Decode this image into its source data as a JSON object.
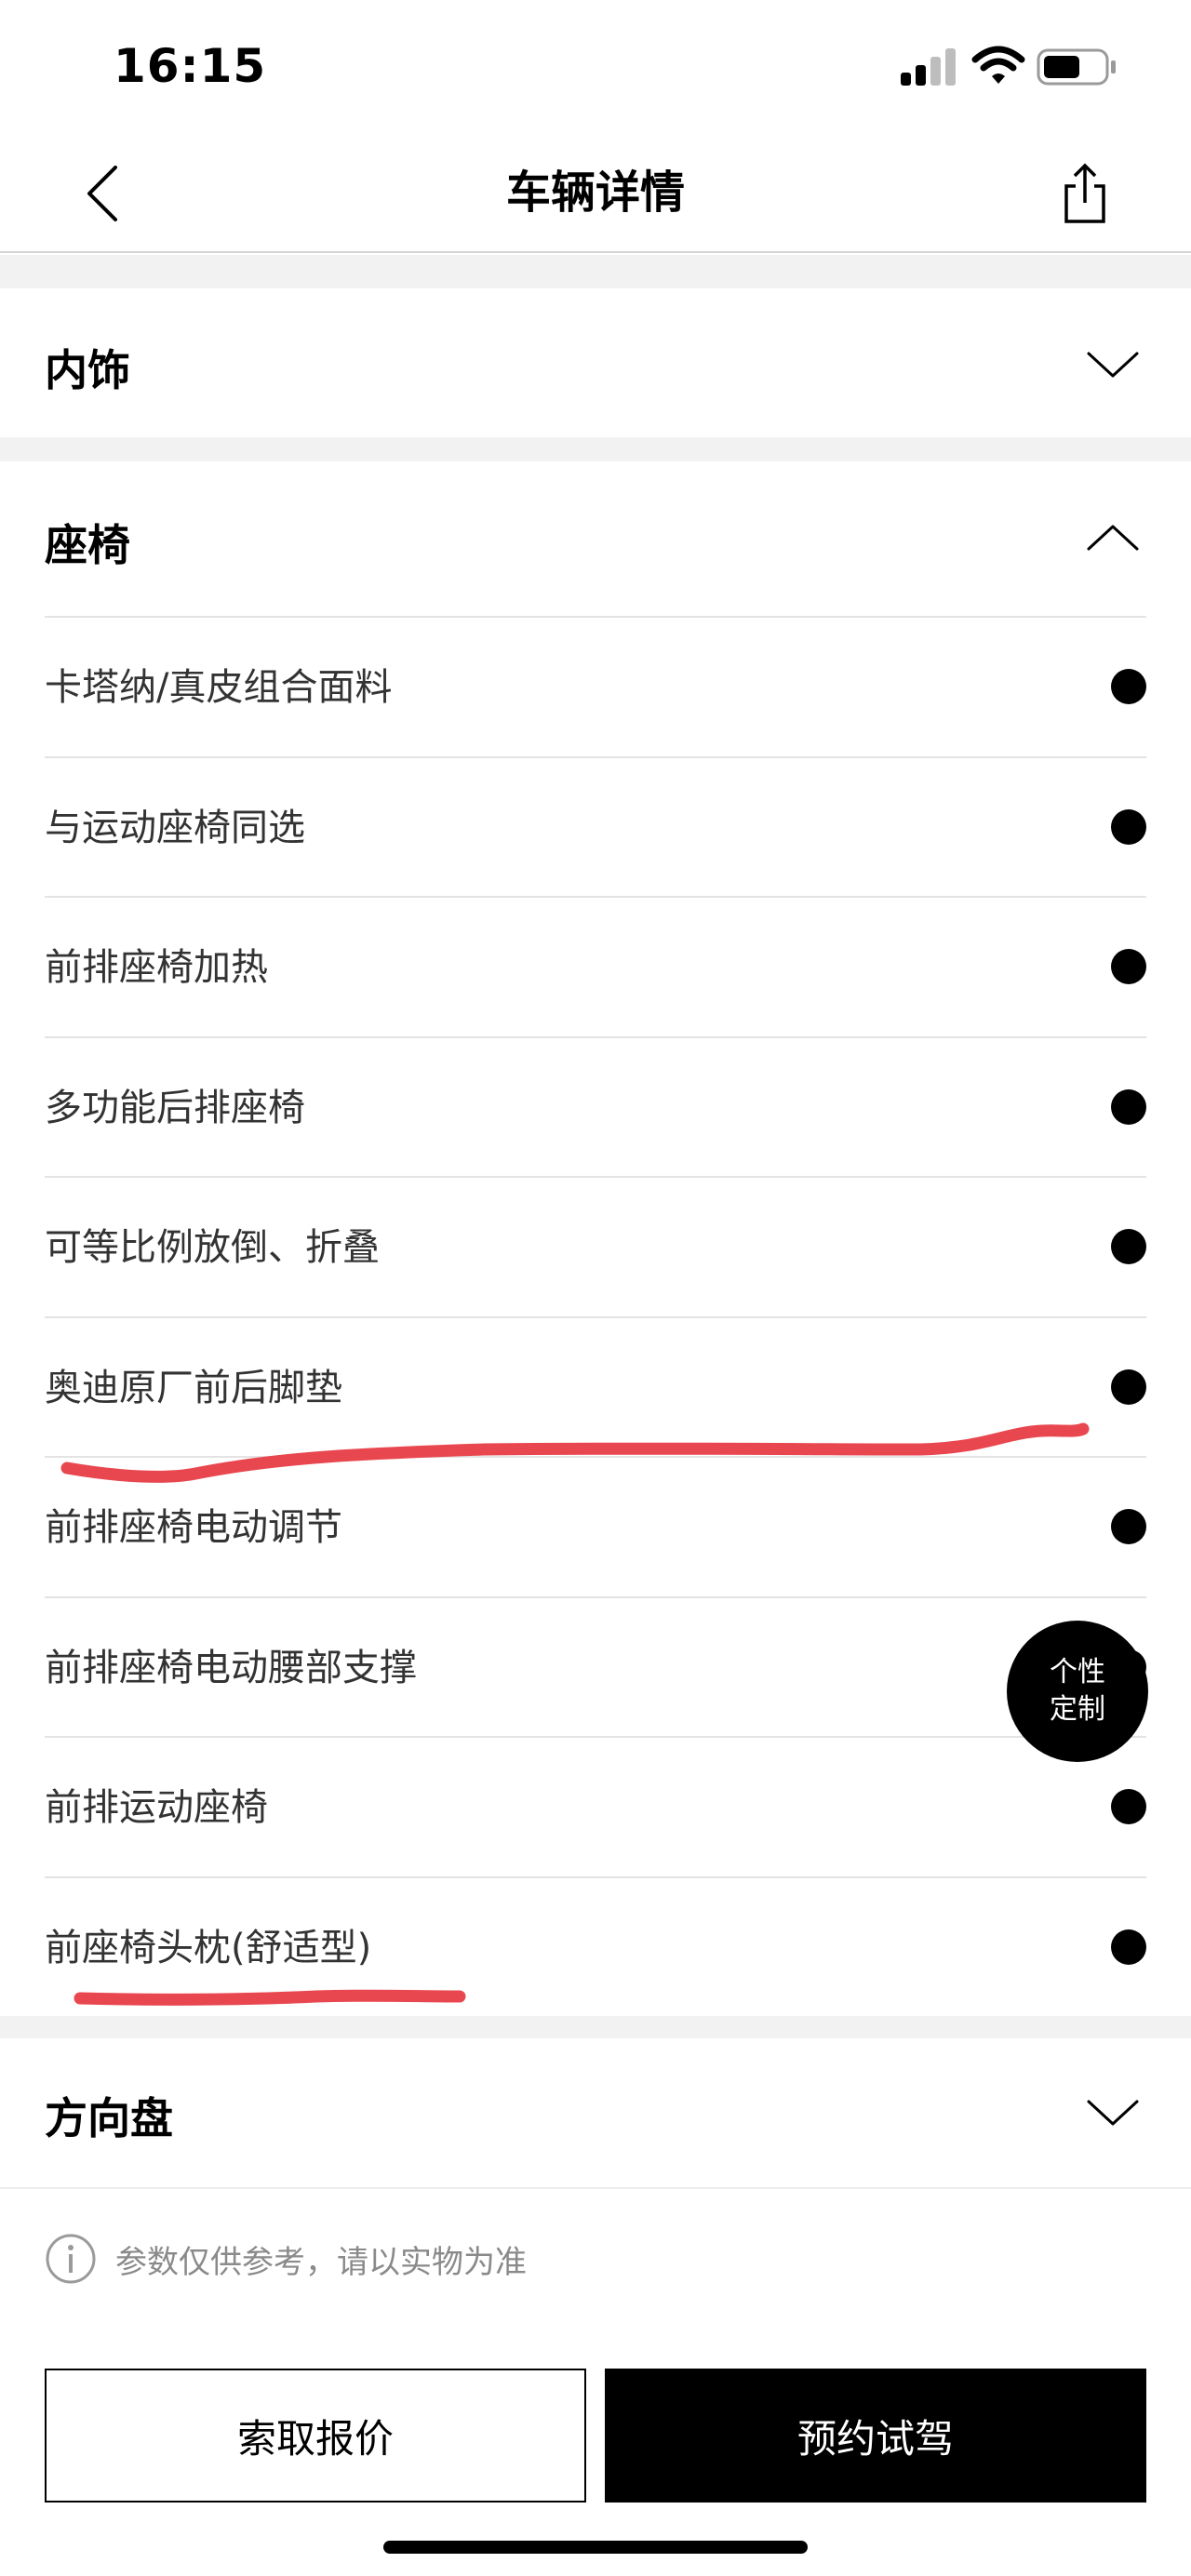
{
  "status_bar": {
    "time": "16:15"
  },
  "nav": {
    "title": "车辆详情"
  },
  "sections": {
    "interior": {
      "title": "内饰",
      "state": "collapsed"
    },
    "seats": {
      "title": "座椅",
      "state": "expanded"
    },
    "steering": {
      "title": "方向盘",
      "state": "collapsed"
    }
  },
  "seat_items": [
    "卡塔纳/真皮组合面料",
    "与运动座椅同选",
    "前排座椅加热",
    "多功能后排座椅",
    "可等比例放倒、折叠",
    "奥迪原厂前后脚垫",
    "前排座椅电动调节",
    "前排座椅电动腰部支撑",
    "前排运动座椅",
    "前座椅头枕(舒适型)"
  ],
  "fab": {
    "line1": "个性",
    "line2": "定制"
  },
  "disclaimer": "参数仅供参考，请以实物为准",
  "buttons": {
    "quote": "索取报价",
    "test_drive": "预约试驾"
  },
  "colors": {
    "annotation_red": "#e8474f",
    "primary": "#000000",
    "divider": "#e3e3e3",
    "band": "#f2f2f2"
  }
}
